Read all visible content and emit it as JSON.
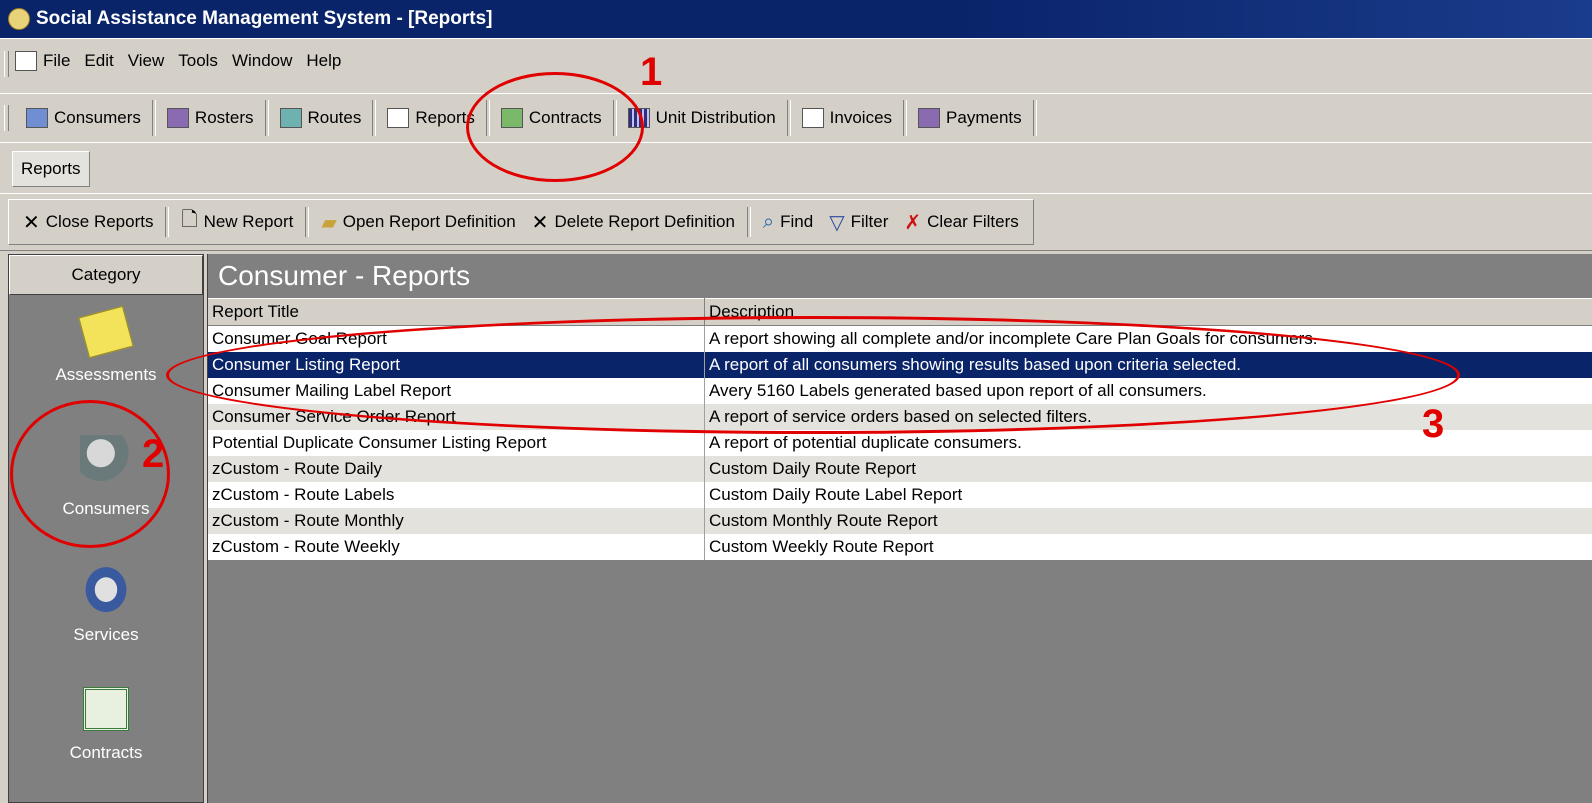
{
  "window": {
    "title": "Social Assistance Management System - [Reports]"
  },
  "menu": [
    "File",
    "Edit",
    "View",
    "Tools",
    "Window",
    "Help"
  ],
  "nav": {
    "consumers": "Consumers",
    "rosters": "Rosters",
    "routes": "Routes",
    "reports": "Reports",
    "contracts": "Contracts",
    "unit_distribution": "Unit Distribution",
    "invoices": "Invoices",
    "payments": "Payments"
  },
  "tab": {
    "label": "Reports"
  },
  "actions": {
    "close": "Close Reports",
    "new": "New Report",
    "open": "Open Report Definition",
    "delete": "Delete Report Definition",
    "find": "Find",
    "filter": "Filter",
    "clear": "Clear Filters"
  },
  "category": {
    "header": "Category",
    "items": [
      "Assessments",
      "Consumers",
      "Services",
      "Contracts"
    ]
  },
  "main": {
    "title": "Consumer - Reports",
    "columns": [
      "Report Title",
      "Description"
    ],
    "rows": [
      [
        "Consumer Goal Report",
        "A report showing all complete and/or incomplete Care Plan Goals for consumers."
      ],
      [
        "Consumer Listing Report",
        "A report of all consumers showing results based upon criteria selected."
      ],
      [
        "Consumer Mailing Label Report",
        "Avery 5160 Labels generated based upon report of all consumers."
      ],
      [
        "Consumer Service Order Report",
        "A report of service orders based on selected filters."
      ],
      [
        "Potential Duplicate Consumer Listing Report",
        "A report of potential duplicate consumers."
      ],
      [
        "zCustom - Route Daily",
        "Custom Daily Route Report"
      ],
      [
        "zCustom - Route Labels",
        "Custom Daily Route Label Report"
      ],
      [
        "zCustom - Route Monthly",
        "Custom Monthly Route Report"
      ],
      [
        "zCustom - Route Weekly",
        "Custom Weekly Route Report"
      ]
    ]
  },
  "annotations": [
    "1",
    "2",
    "3"
  ],
  "colors": {
    "annotation": "#e10000",
    "selection": "#0a246a",
    "title_bar": "#0a246a"
  }
}
